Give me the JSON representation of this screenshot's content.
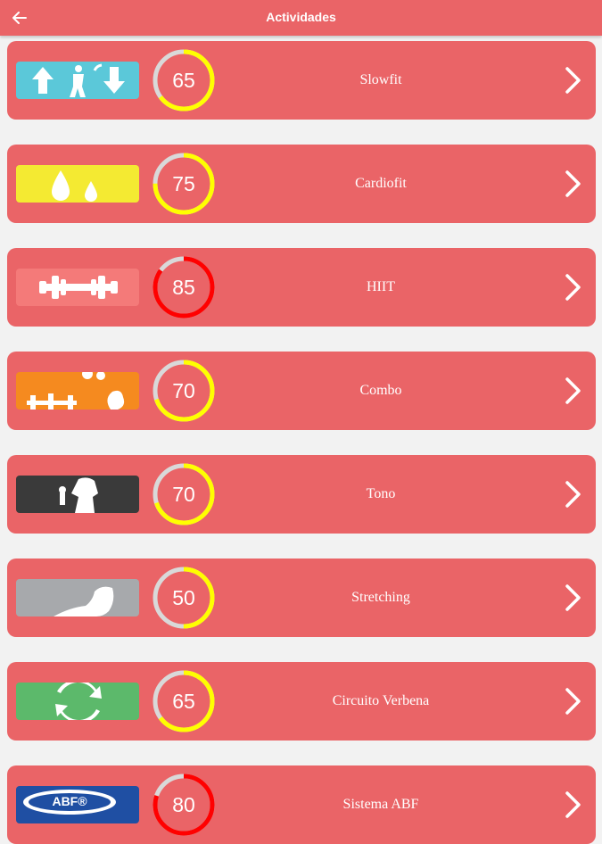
{
  "appbar": {
    "title": "Actividades",
    "back_icon": "arrow-left-icon"
  },
  "colors": {
    "appbar": "#ea6467",
    "card": "#ea6467",
    "background": "#f2f2f2",
    "gauge_track": "#d9d9d9",
    "gauge_yellow": "#ffff00",
    "gauge_red": "#ff0000"
  },
  "activities": [
    {
      "name": "Slowfit",
      "intensity": 65,
      "gauge_color": "#ffff00",
      "thumb_color": "#5bc8d9",
      "icon": "up-down-arrows-figure-icon"
    },
    {
      "name": "Cardiofit",
      "intensity": 75,
      "gauge_color": "#ffff00",
      "thumb_color": "#f4ea32",
      "icon": "sweat-drops-icon"
    },
    {
      "name": "HIIT",
      "intensity": 85,
      "gauge_color": "#ff0000",
      "thumb_color": "#f47a79",
      "icon": "dumbbell-icon"
    },
    {
      "name": "Combo",
      "intensity": 70,
      "gauge_color": "#ffff00",
      "thumb_color": "#f58a1f",
      "icon": "dumbbell-arm-icon"
    },
    {
      "name": "Tono",
      "intensity": 70,
      "gauge_color": "#ffff00",
      "thumb_color": "#3a3a3a",
      "icon": "torso-dumbbell-icon"
    },
    {
      "name": "Stretching",
      "intensity": 50,
      "gauge_color": "#ffff00",
      "thumb_color": "#a7a9ac",
      "icon": "stretching-arm-icon"
    },
    {
      "name": "Circuito Verbena",
      "intensity": 65,
      "gauge_color": "#ffff00",
      "thumb_color": "#5cb96b",
      "icon": "circular-arrows-icon"
    },
    {
      "name": "Sistema ABF",
      "intensity": 80,
      "gauge_color": "#ff0000",
      "thumb_color": "#1f4fa3",
      "icon": "abf-logo-icon",
      "thumb_text": "ABF®"
    }
  ]
}
